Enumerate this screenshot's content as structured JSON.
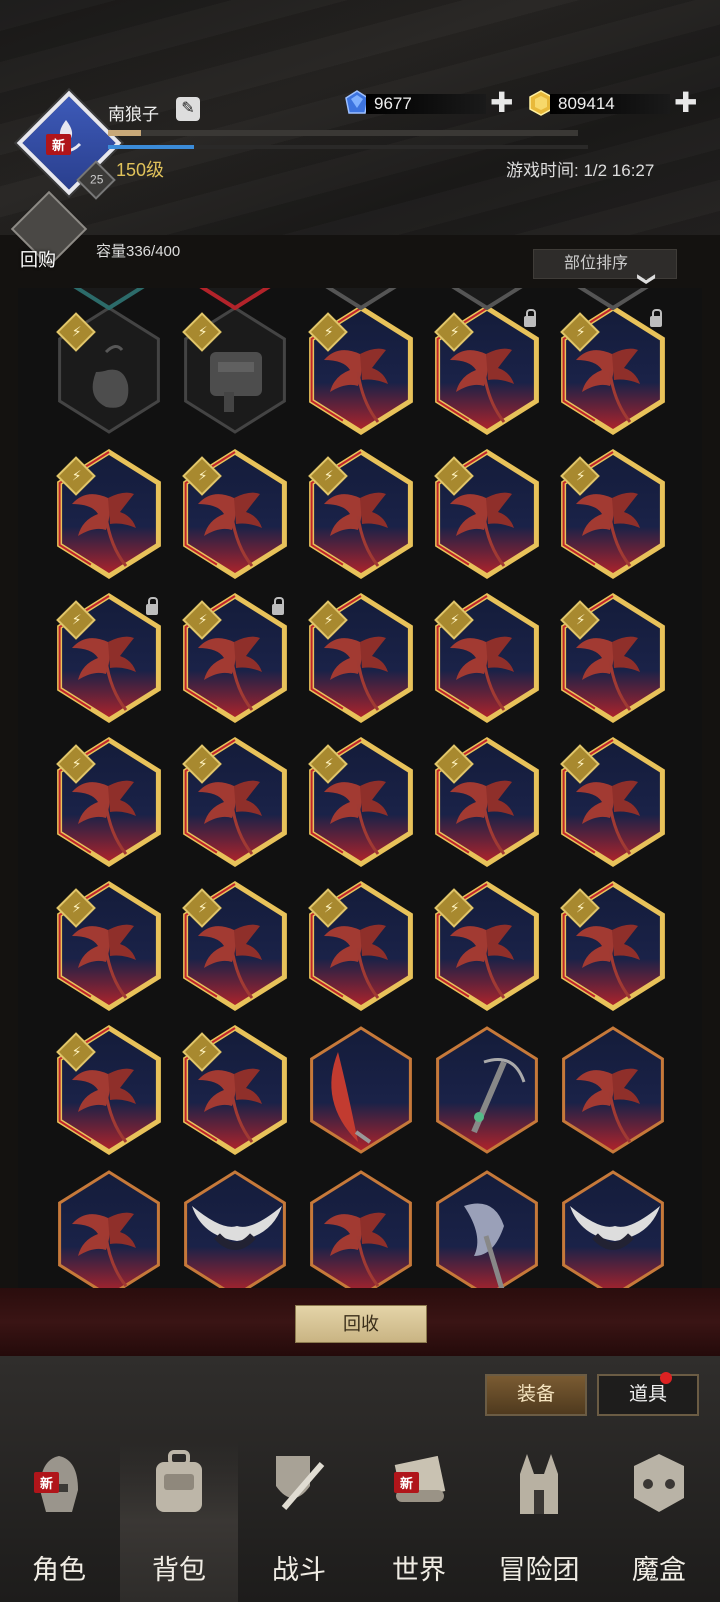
{
  "player": {
    "name": "南狼子",
    "level": "150级",
    "avatar_badge": "25",
    "new_tag": "新",
    "xp_fraction": 0.07,
    "mp_fraction": 0.18
  },
  "currency": {
    "gems": "9677",
    "gold": "809414",
    "plus": "✚"
  },
  "game_time": "游戏时间: 1/2 16:27",
  "bag": {
    "buyback_label": "回购",
    "capacity": "容量336/400",
    "sort_label": "部位排序",
    "recycle_label": "回收"
  },
  "icons": {
    "bolt": "⚡",
    "chevron": "❯"
  },
  "grid": {
    "rows": [
      [
        "pouch",
        "bag",
        "wing",
        "wing",
        "wing"
      ],
      [
        "wing",
        "wing",
        "wing",
        "wing",
        "wing"
      ],
      [
        "wing",
        "wing",
        "wing",
        "wing",
        "wing"
      ],
      [
        "wing",
        "wing",
        "wing",
        "wing",
        "wing"
      ],
      [
        "wing",
        "wing",
        "wing",
        "wing",
        "wing"
      ],
      [
        "wing",
        "wing",
        "blade",
        "crossbow",
        "wing-plain"
      ],
      [
        "wing-plain",
        "horns",
        "wing-plain",
        "axe",
        "horns"
      ]
    ],
    "bolt_rows": [
      [
        true,
        true,
        true,
        true,
        true
      ],
      [
        true,
        true,
        true,
        true,
        true
      ],
      [
        true,
        true,
        true,
        true,
        true
      ],
      [
        true,
        true,
        true,
        true,
        true
      ],
      [
        true,
        true,
        true,
        true,
        true
      ],
      [
        true,
        true,
        false,
        false,
        false
      ],
      [
        false,
        false,
        false,
        false,
        false
      ]
    ],
    "locked": [
      [
        0,
        2
      ],
      [
        0,
        4
      ],
      [
        2,
        2
      ],
      [
        2,
        4
      ]
    ],
    "locked_cells": [
      [
        0,
        3
      ],
      [
        0,
        4
      ],
      [
        2,
        0
      ],
      [
        2,
        1
      ]
    ]
  },
  "toggles": {
    "equip": "装备",
    "items": "道具"
  },
  "nav": [
    {
      "label": "角色",
      "icon": "helmet-icon",
      "new": true
    },
    {
      "label": "背包",
      "icon": "backpack-icon",
      "new": false,
      "selected": true
    },
    {
      "label": "战斗",
      "icon": "sword-shield-icon",
      "new": false
    },
    {
      "label": "世界",
      "icon": "scroll-icon",
      "new": true
    },
    {
      "label": "冒险团",
      "icon": "castle-icon",
      "new": false
    },
    {
      "label": "魔盒",
      "icon": "dice-box-icon",
      "new": false
    }
  ],
  "colors": {
    "gold_frame": "#e8c25a",
    "red_frame": "#c1242a",
    "gem_blue": "#3d74e0",
    "gold_coin": "#e8b93a"
  }
}
